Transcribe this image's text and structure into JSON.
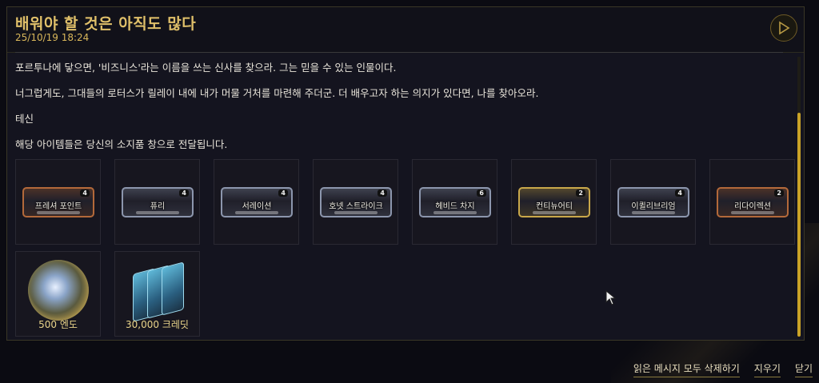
{
  "message": {
    "title": "배워야 할 것은 아직도 많다",
    "date": "25/10/19 18:24",
    "paragraphs": [
      "포르투나에 닿으면, '비즈니스'라는 이름을 쓰는 신사를 찾으라. 그는 믿을 수 있는 인물이다.",
      "너그럽게도, 그대들의 로터스가 릴레이 내에 내가 머물 거처를 마련해 주더군. 더 배우고자 하는 의지가 있다면, 나를 찾아오라.",
      "테신",
      "해당 아이템들은 당신의 소지품 창으로 전달됩니다."
    ]
  },
  "mods": [
    {
      "name": "프레셔 포인트",
      "rank": "4",
      "color": "#b3693a"
    },
    {
      "name": "퓨리",
      "rank": "4",
      "color": "#8c96ad"
    },
    {
      "name": "서레이션",
      "rank": "4",
      "color": "#8c96ad"
    },
    {
      "name": "호넷 스트라이크",
      "rank": "4",
      "color": "#8c96ad"
    },
    {
      "name": "헤비드 차지",
      "rank": "6",
      "color": "#8c96ad"
    },
    {
      "name": "컨티뉴어티",
      "rank": "2",
      "color": "#c9a84a"
    },
    {
      "name": "이퀼리브리엄",
      "rank": "4",
      "color": "#8c96ad"
    },
    {
      "name": "리다이렉션",
      "rank": "2",
      "color": "#b3693a"
    }
  ],
  "rewards": [
    {
      "label": "500 엔도",
      "icon": "endo-icon"
    },
    {
      "label": "30,000 크레딧",
      "icon": "credits-icon"
    }
  ],
  "footer": {
    "delete_read": "읽은 메시지 모두 삭제하기",
    "delete": "지우기",
    "close": "닫기"
  },
  "colors": {
    "accent": "#e0c06a",
    "scrollbar": "#c9a227",
    "panel_bg": "#14141f"
  }
}
